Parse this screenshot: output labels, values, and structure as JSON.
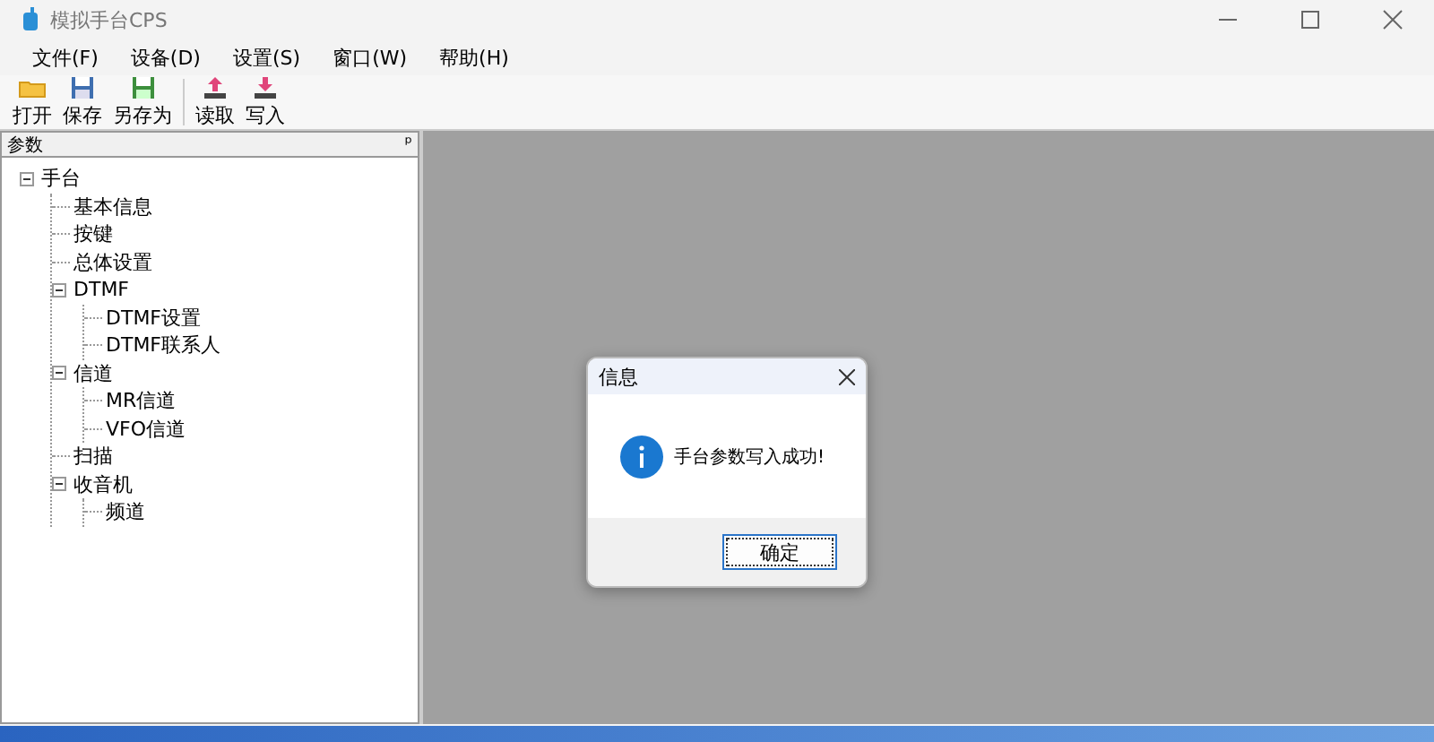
{
  "window": {
    "title": "模拟手台CPS"
  },
  "menu": [
    "文件(F)",
    "设备(D)",
    "设置(S)",
    "窗口(W)",
    "帮助(H)"
  ],
  "toolbar": [
    {
      "kind": "open",
      "label": "打开"
    },
    {
      "kind": "save",
      "label": "保存"
    },
    {
      "kind": "saveas",
      "label": "另存为"
    },
    {
      "kind": "separator"
    },
    {
      "kind": "read",
      "label": "读取"
    },
    {
      "kind": "write",
      "label": "写入"
    }
  ],
  "panel": {
    "title": "参数",
    "pin": "ᵖ"
  },
  "tree": [
    {
      "label": "手台",
      "expanded": true,
      "children": [
        {
          "label": "基本信息"
        },
        {
          "label": "按键"
        },
        {
          "label": "总体设置"
        },
        {
          "label": "DTMF",
          "expanded": true,
          "children": [
            {
              "label": "DTMF设置"
            },
            {
              "label": "DTMF联系人"
            }
          ]
        },
        {
          "label": "信道",
          "expanded": true,
          "children": [
            {
              "label": "MR信道"
            },
            {
              "label": "VFO信道"
            }
          ]
        },
        {
          "label": "扫描"
        },
        {
          "label": "收音机",
          "expanded": true,
          "children": [
            {
              "label": "频道"
            }
          ]
        }
      ]
    }
  ],
  "dialog": {
    "title": "信息",
    "message": "手台参数写入成功!",
    "button": "确定"
  }
}
